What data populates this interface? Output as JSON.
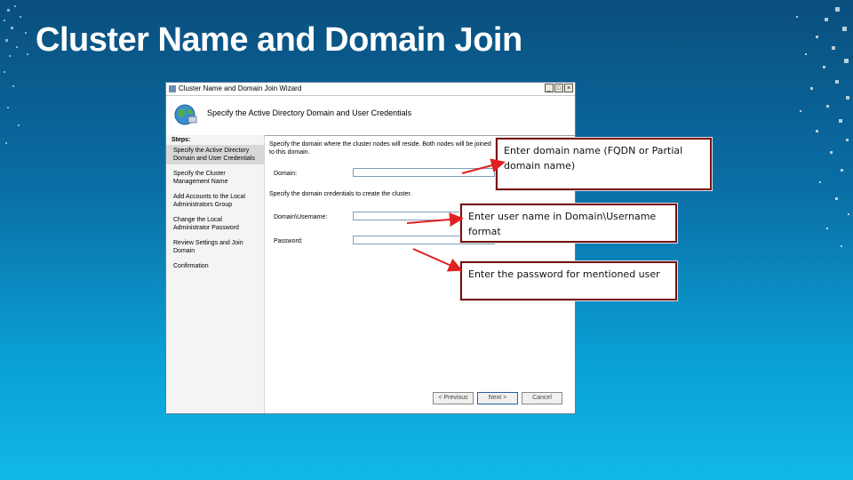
{
  "slide": {
    "title": "Cluster Name and Domain Join"
  },
  "wizard": {
    "window_title": "Cluster Name and Domain Join Wizard",
    "header": "Specify the Active Directory Domain and User Credentials",
    "steps_title": "Steps:",
    "steps": [
      "Specify the Active Directory Domain and User Credentials",
      "Specify the Cluster Management Name",
      "Add Accounts to the Local Administrators Group",
      "Change the Local Administrator Password",
      "Review Settings and Join Domain",
      "Confirmation"
    ],
    "intro_text": "Specify the domain where the cluster nodes will reside. Both nodes will be joined to this domain.",
    "domain_label": "Domain:",
    "domain_value": "",
    "credentials_text": "Specify the domain credentials to create the cluster.",
    "username_label": "Domain\\Username:",
    "username_value": "",
    "password_label": "Password:",
    "password_value": "",
    "buttons": {
      "previous": "< Previous",
      "next": "Next >",
      "cancel": "Cancel"
    }
  },
  "callouts": {
    "domain": "Enter domain name (FQDN or Partial domain name)",
    "username": "Enter user name in Domain\\Username format",
    "password": "Enter the password for mentioned user"
  },
  "colors": {
    "arrow": "#e02020",
    "callout_border": "#7a1010"
  }
}
